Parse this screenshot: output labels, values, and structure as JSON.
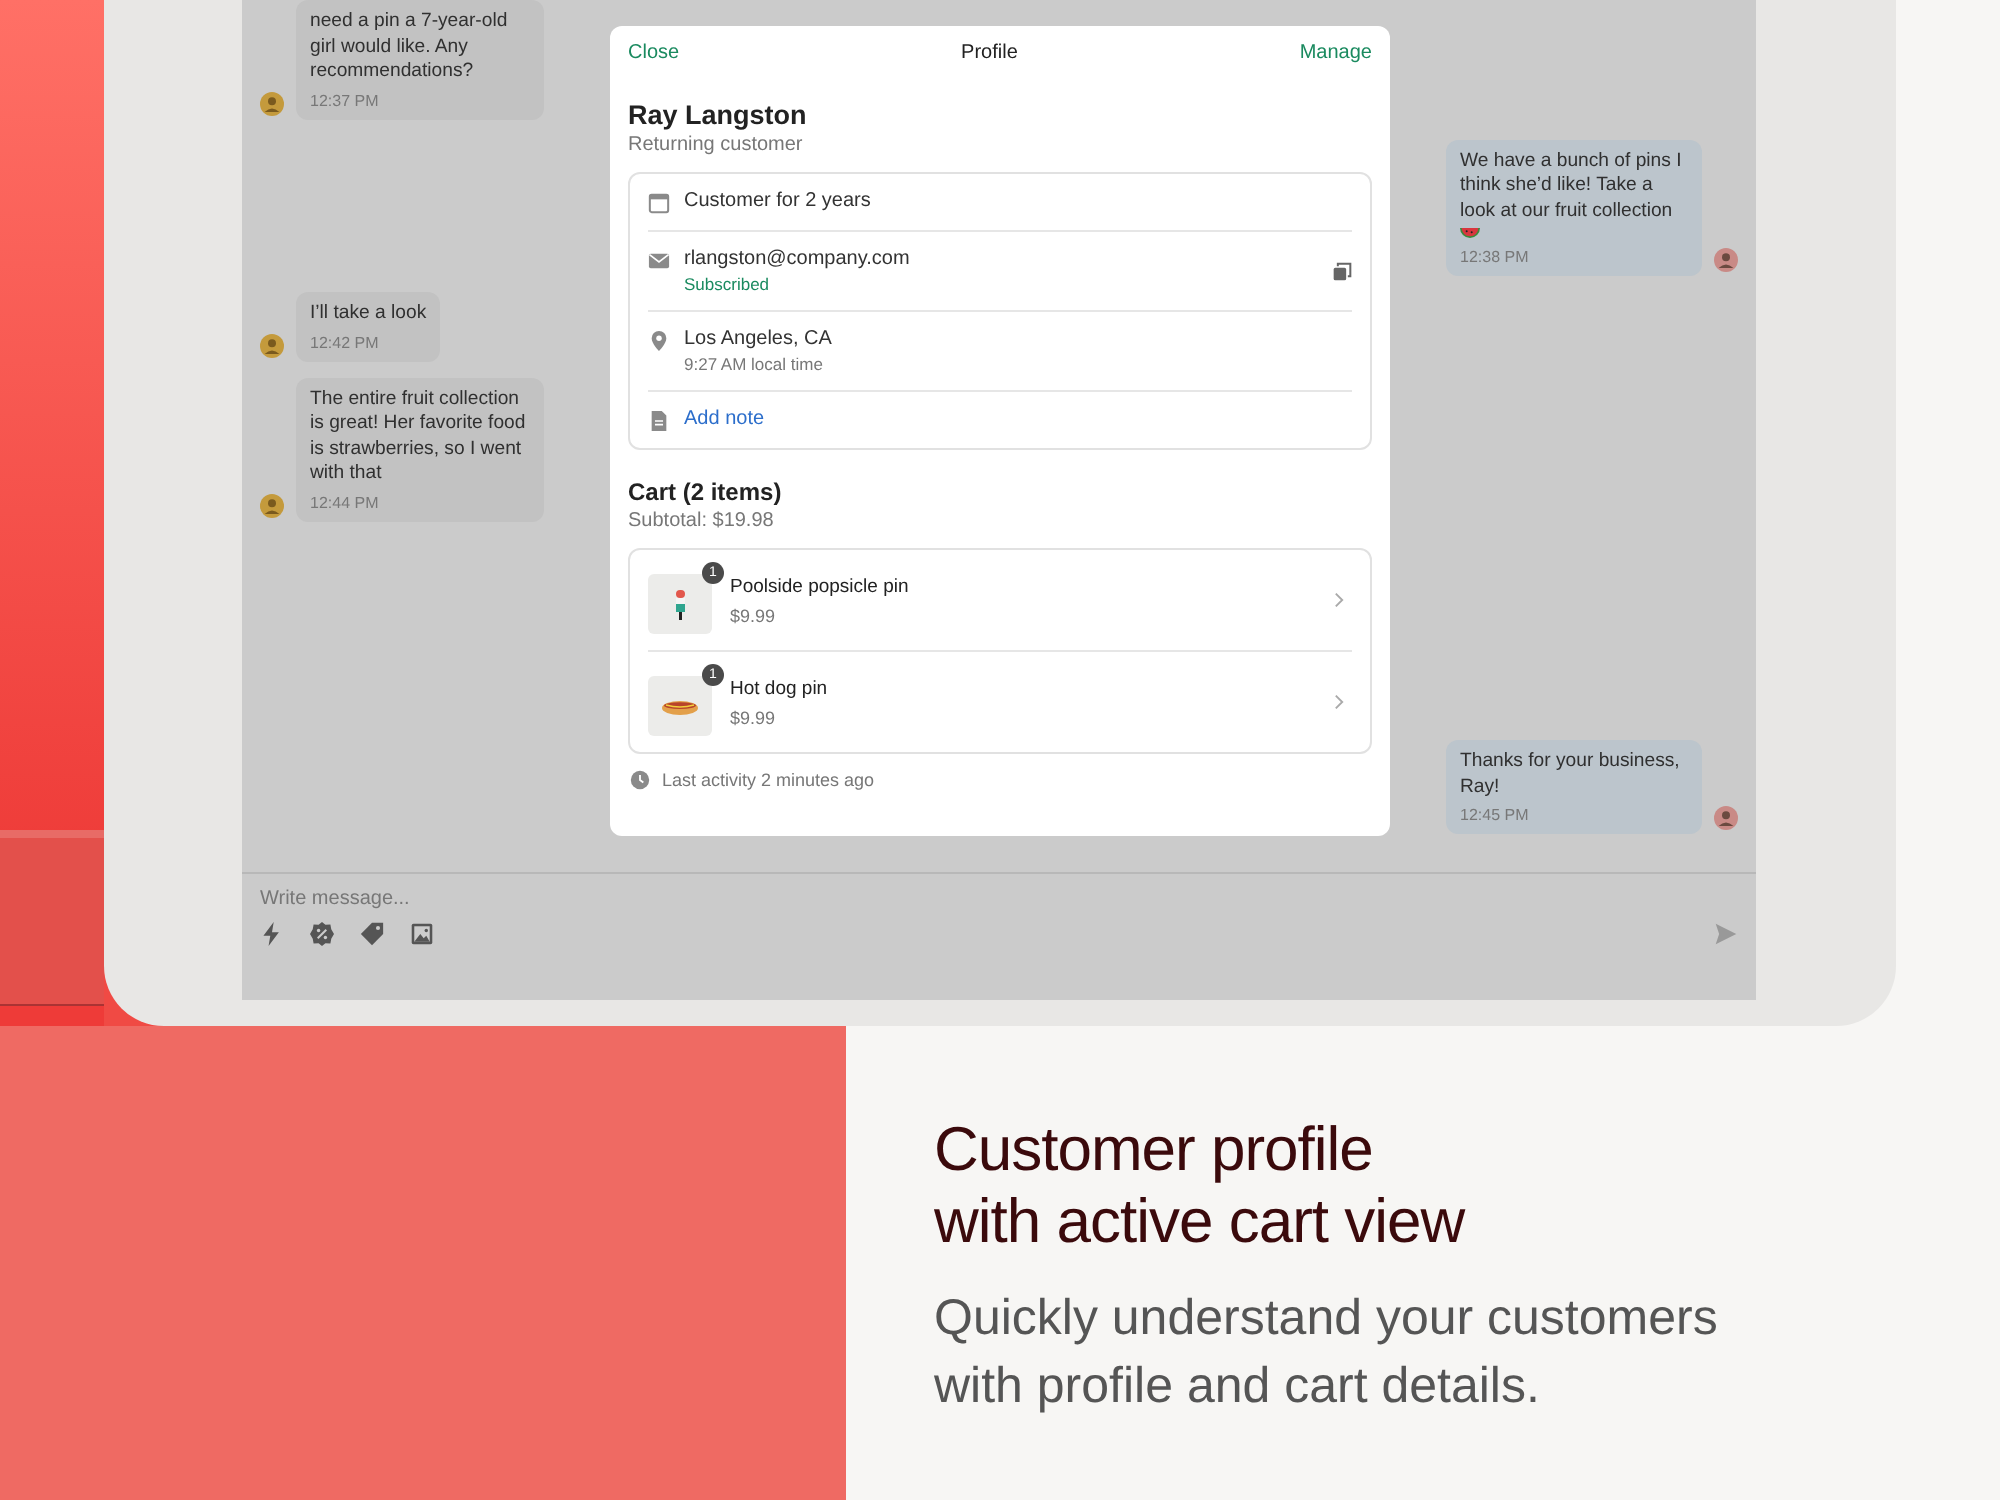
{
  "chat": {
    "messages": [
      {
        "kind": "incoming",
        "text": "need a pin a 7-year-old girl would like. Any recommendations?",
        "time": "12:37 PM",
        "emoji": false
      },
      {
        "kind": "outgoing",
        "text": "We have a bunch of pins I think she’d like! Take a look at our fruit collection",
        "time": "12:38 PM",
        "emoji": true
      },
      {
        "kind": "incoming",
        "text": "I’ll take a look",
        "time": "12:42 PM",
        "emoji": false
      },
      {
        "kind": "incoming",
        "text": "The entire fruit collection is great! Her favorite food is strawberries, so I went with that",
        "time": "12:44 PM",
        "emoji": false
      },
      {
        "kind": "outgoing",
        "text": "Thanks for your business, Ray!",
        "time": "12:45 PM",
        "emoji": false
      }
    ],
    "composer": {
      "placeholder": "Write message..."
    }
  },
  "profile": {
    "close": "Close",
    "title": "Profile",
    "manage": "Manage",
    "name": "Ray Langston",
    "status": "Returning customer",
    "details": [
      {
        "kind": "tenure",
        "text": "Customer for 2 years"
      },
      {
        "kind": "email",
        "text": "rlangston@company.com",
        "note": "Subscribed"
      },
      {
        "kind": "location",
        "text": "Los Angeles, CA",
        "note": "9:27 AM local time"
      },
      {
        "kind": "note",
        "text": "Add note"
      }
    ],
    "cart": {
      "title": "Cart (2 items)",
      "subtotal": "Subtotal: $19.98",
      "items": [
        {
          "name": "Poolside popsicle pin",
          "price": "$9.99",
          "quantity": "1",
          "kind": "picture"
        },
        {
          "name": "Hot dog pin",
          "price": "$9.99",
          "quantity": "1",
          "kind": "picture"
        }
      ],
      "last_activity": "Last activity 2 minutes ago"
    }
  },
  "promo": {
    "headline": "Customer profile\nwith active cart view",
    "text": "Quickly understand your customers\nwith profile and cart details."
  }
}
